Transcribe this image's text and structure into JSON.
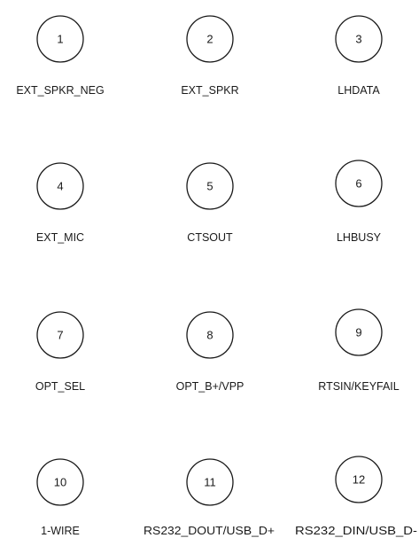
{
  "pins": [
    {
      "number": "1",
      "label": "EXT_SPKR_NEG"
    },
    {
      "number": "2",
      "label": "EXT_SPKR"
    },
    {
      "number": "3",
      "label": "LHDATA"
    },
    {
      "number": "4",
      "label": "EXT_MIC"
    },
    {
      "number": "5",
      "label": "CTSOUT"
    },
    {
      "number": "6",
      "label": "LHBUSY"
    },
    {
      "number": "7",
      "label": "OPT_SEL"
    },
    {
      "number": "8",
      "label": "OPT_B+/VPP"
    },
    {
      "number": "9",
      "label": "RTSIN/KEYFAIL"
    },
    {
      "number": "10",
      "label": "1-WIRE"
    },
    {
      "number": "11",
      "label": "RS232_DOUT/USB_D+"
    },
    {
      "number": "12",
      "label": "RS232_DIN/USB_D-"
    }
  ]
}
